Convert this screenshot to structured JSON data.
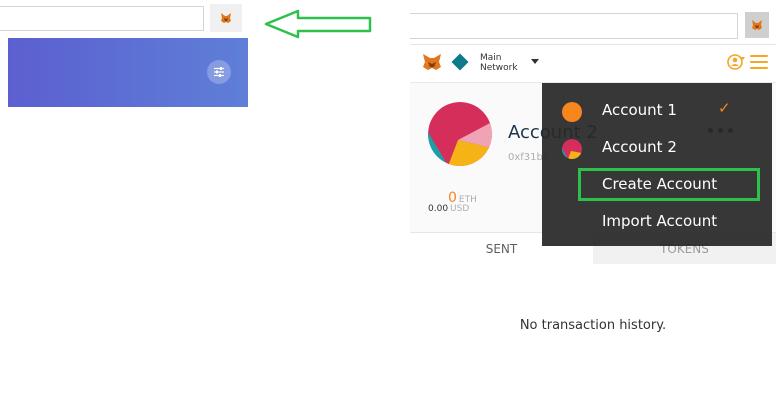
{
  "popup": {
    "network": {
      "line1": "Main",
      "line2": "Network"
    },
    "account": {
      "name": "Account 2",
      "address": "0xf31b8",
      "balance_eth_value": "0",
      "balance_eth_unit": "ETH",
      "balance_usd_value": "0.00",
      "balance_usd_unit": "USD",
      "menu_label": "•••"
    },
    "tabs": {
      "sent": "SENT",
      "tokens": "TOKENS"
    },
    "empty_state": "No transaction history."
  },
  "dropdown": {
    "items": [
      {
        "label": "Account 1"
      },
      {
        "label": "Account 2"
      },
      {
        "label": "Create Account"
      },
      {
        "label": "Import Account"
      }
    ],
    "selected_mark": "✓"
  },
  "colors": {
    "banner_start": "#5c5fd0",
    "banner_end": "#5e7fd8",
    "accent_orange": "#f7861c",
    "highlight_green": "#2ec04a",
    "arrow_green": "#2ec04a",
    "dropdown_bg": "#282828"
  },
  "icons": {
    "extension": "metamask-fox-icon",
    "settings": "sliders-icon",
    "network": "diamond-icon",
    "account": "account-switch-icon",
    "menu": "hamburger-icon",
    "check": "check-icon"
  }
}
